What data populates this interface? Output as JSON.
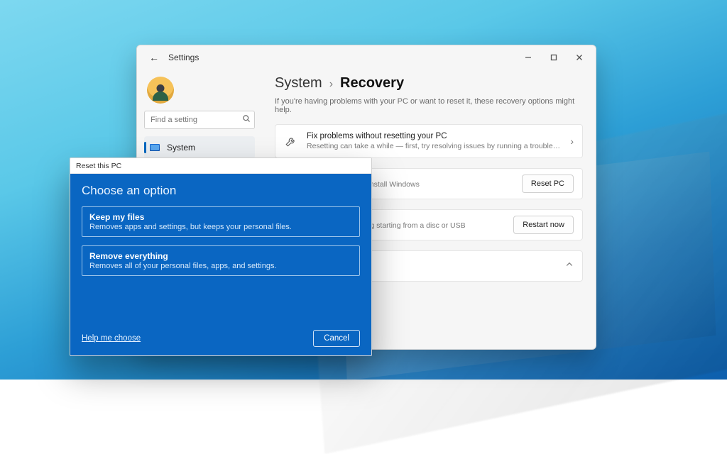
{
  "window": {
    "title": "Settings",
    "caption": {
      "minimize": "Minimize",
      "maximize": "Maximize",
      "close": "Close"
    }
  },
  "sidebar": {
    "search_placeholder": "Find a setting",
    "items": [
      {
        "label": "System"
      }
    ]
  },
  "breadcrumb": {
    "a": "System",
    "b": "Recovery"
  },
  "subtitle": "If you're having problems with your PC or want to reset it, these recovery options might help.",
  "fix_card": {
    "title": "Fix problems without resetting your PC",
    "desc": "Resetting can take a while — first, try resolving issues by running a troubleshooter"
  },
  "reset_row": {
    "desc": "our personal files, then reinstall Windows",
    "button": "Reset PC"
  },
  "startup_row": {
    "desc": "e startup settings, including starting from a disc or USB",
    "button": "Restart now"
  },
  "dialog": {
    "window_title": "Reset this PC",
    "heading": "Choose an option",
    "options": [
      {
        "title": "Keep my files",
        "desc": "Removes apps and settings, but keeps your personal files."
      },
      {
        "title": "Remove everything",
        "desc": "Removes all of your personal files, apps, and settings."
      }
    ],
    "help": "Help me choose",
    "cancel": "Cancel"
  }
}
